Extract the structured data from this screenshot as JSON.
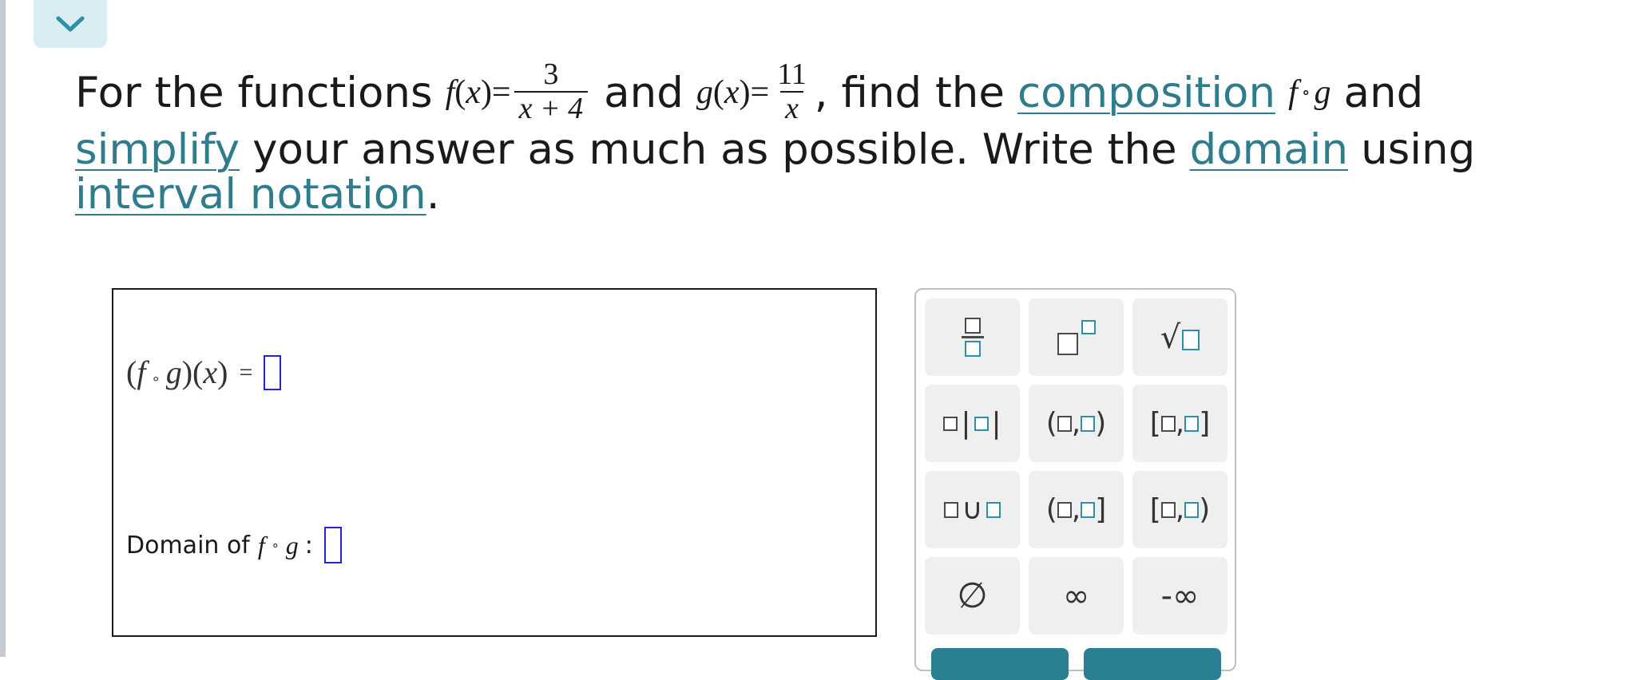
{
  "collapse_button": {
    "icon": "chevron-down-icon"
  },
  "question": {
    "line1_prefix": "For the functions",
    "f_label": "f",
    "x_var": "x",
    "f_num": "3",
    "f_den": "x + 4",
    "and_1": "and",
    "g_label": "g",
    "g_num": "11",
    "g_den": "x",
    "find_the": ", find the",
    "composition_link": "composition",
    "fog_f": "f",
    "fog_g": "g",
    "and_2": "and",
    "simplify_link": "simplify",
    "line2_mid": "your answer as much as possible. Write the",
    "domain_link": "domain",
    "using": "using",
    "interval_link": "interval notation",
    "period": "."
  },
  "answer": {
    "composition_f": "f",
    "composition_g": "g",
    "composition_x": "x",
    "domain_label": "Domain of",
    "domain_f": "f",
    "domain_g": "g",
    "colon": ":"
  },
  "palette": {
    "buttons": [
      {
        "name": "fraction-button",
        "symbol": "fraction"
      },
      {
        "name": "exponent-button",
        "symbol": "exponent"
      },
      {
        "name": "sqrt-button",
        "symbol": "sqrt"
      },
      {
        "name": "absolute-value-button",
        "symbol": "abs"
      },
      {
        "name": "open-interval-button",
        "symbol": "(□,□)"
      },
      {
        "name": "closed-interval-button",
        "symbol": "[□,□]"
      },
      {
        "name": "union-button",
        "symbol": "∪"
      },
      {
        "name": "left-open-interval-button",
        "symbol": "(□,□]"
      },
      {
        "name": "right-open-interval-button",
        "symbol": "[□,□)"
      },
      {
        "name": "empty-set-button",
        "symbol": "∅"
      },
      {
        "name": "infinity-button",
        "symbol": "∞"
      },
      {
        "name": "negative-infinity-button",
        "symbol": "-∞"
      }
    ]
  },
  "colors": {
    "link": "#2e7c8c",
    "accent_box": "#2e8fa8",
    "answer_slot": "#2424d8",
    "button_bg": "#efefef"
  }
}
